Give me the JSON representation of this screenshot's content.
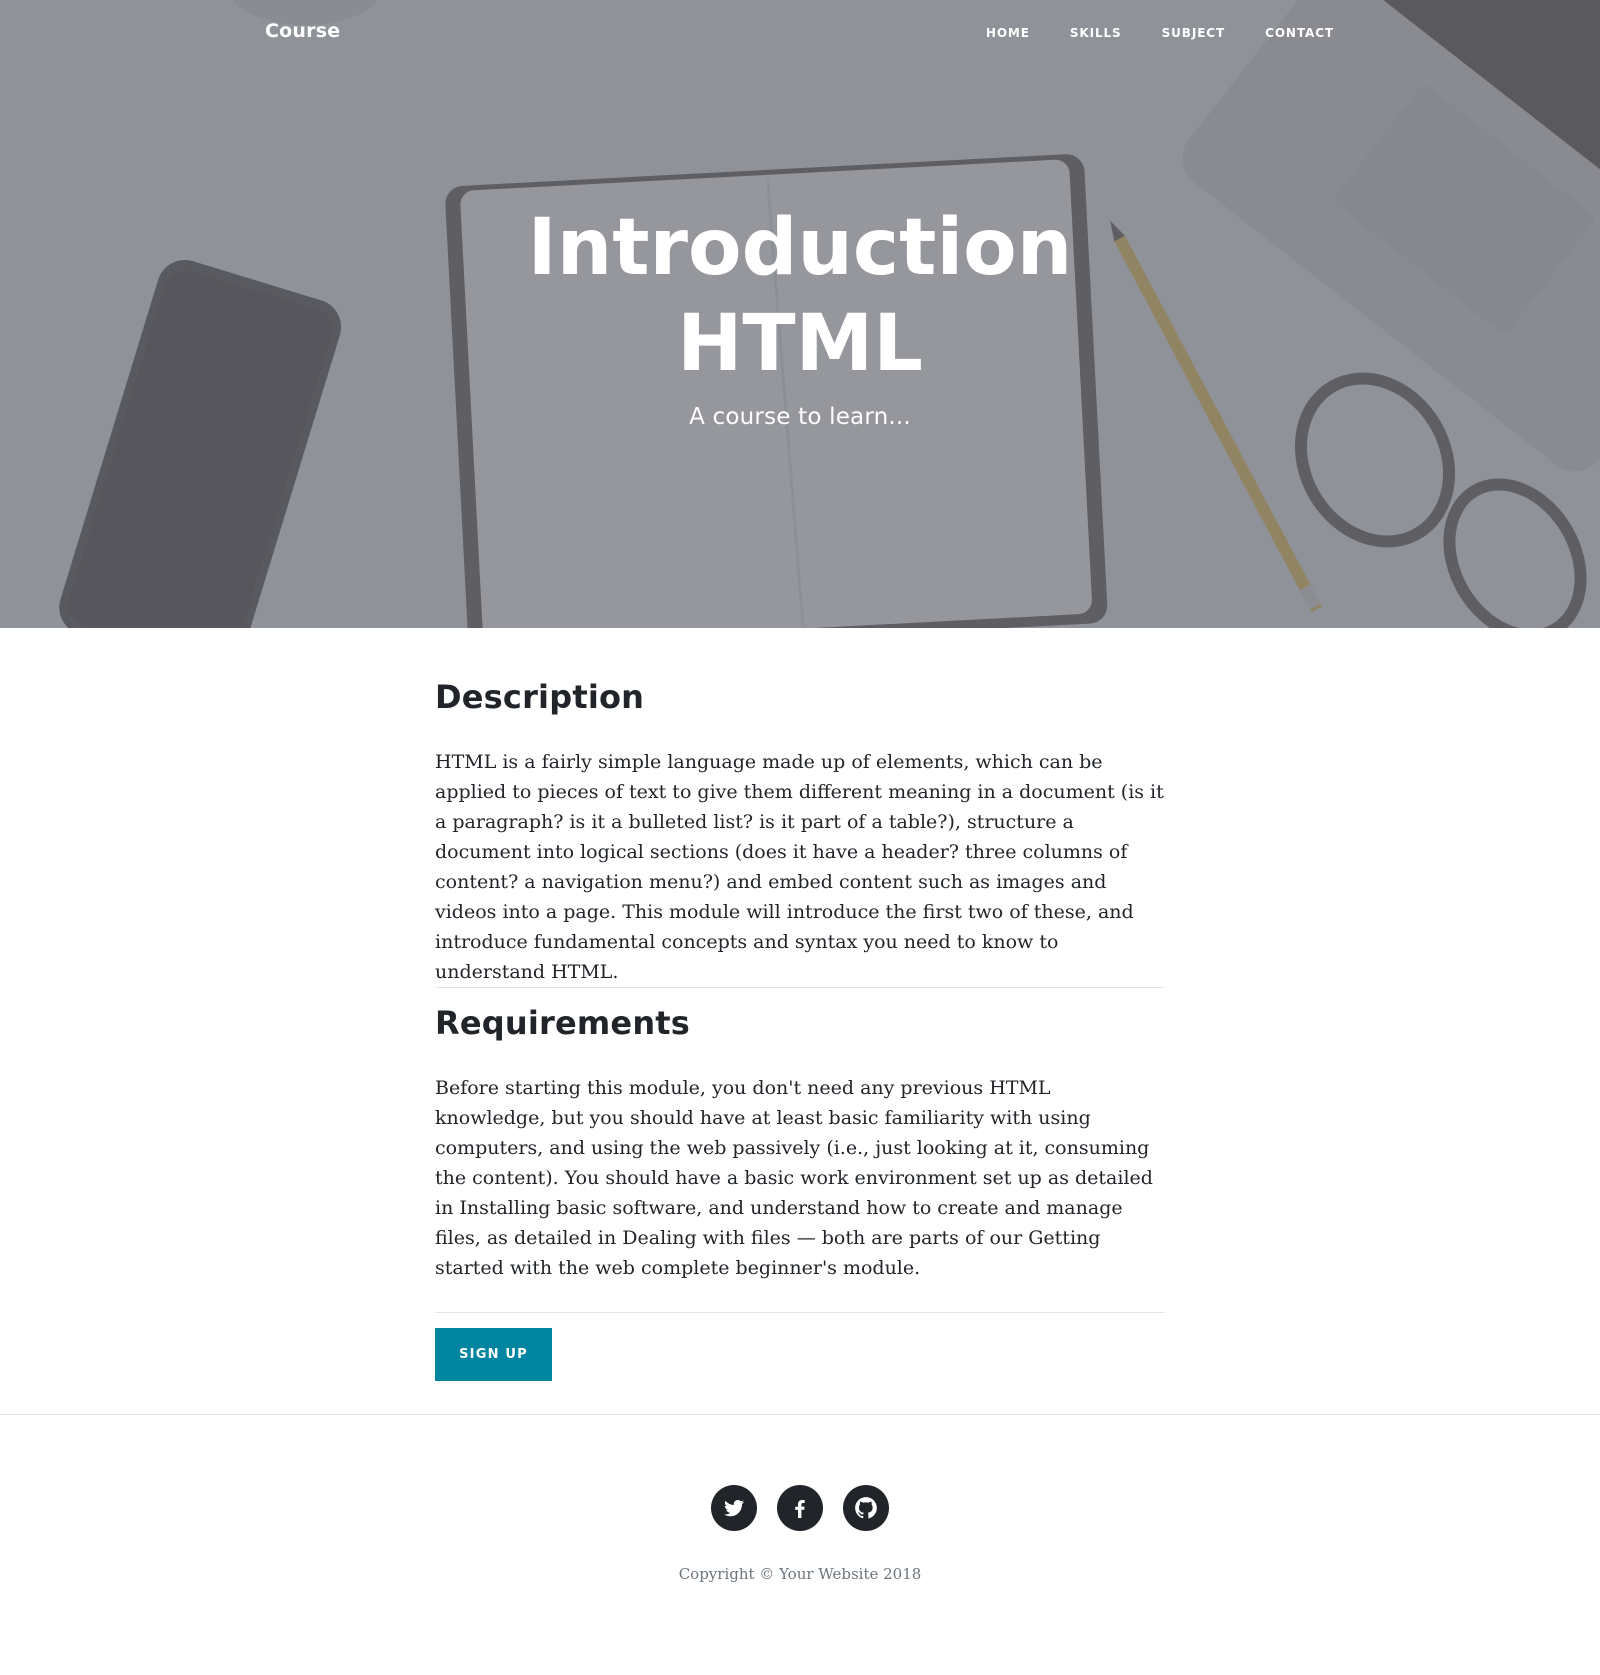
{
  "nav": {
    "brand": "Course",
    "links": [
      {
        "label": "HOME"
      },
      {
        "label": "SKILLS"
      },
      {
        "label": "SUBJECT"
      },
      {
        "label": "CONTACT"
      }
    ]
  },
  "hero": {
    "title": "Introduction HTML",
    "subtitle": "A course to learn..."
  },
  "description": {
    "title": "Description",
    "body": "HTML is a fairly simple language made up of elements, which can be applied to pieces of text to give them different meaning in a document (is it a paragraph? is it a bulleted list? is it part of a table?), structure a document into logical sections (does it have a header? three columns of content? a navigation menu?) and embed content such as images and videos into a page. This module will introduce the first two of these, and introduce fundamental concepts and syntax you need to know to understand HTML."
  },
  "requirements": {
    "title": "Requirements",
    "body": "Before starting this module, you don't need any previous HTML knowledge, but you should have at least basic familiarity with using computers, and using the web passively (i.e., just looking at it, consuming the content). You should have a basic work environment set up as detailed in Installing basic software, and understand how to create and manage files, as detailed in Dealing with files — both are parts of our Getting started with the web complete beginner's module."
  },
  "signup": {
    "label": "SIGN UP"
  },
  "footer": {
    "social": [
      {
        "icon": "twitter-icon"
      },
      {
        "icon": "facebook-icon"
      },
      {
        "icon": "github-icon"
      }
    ],
    "copyright": "Copyright © Your Website 2018"
  },
  "colors": {
    "accent": "#0085a1",
    "text": "#212529",
    "muted": "#6c757d",
    "overlay": "#6e7078"
  }
}
